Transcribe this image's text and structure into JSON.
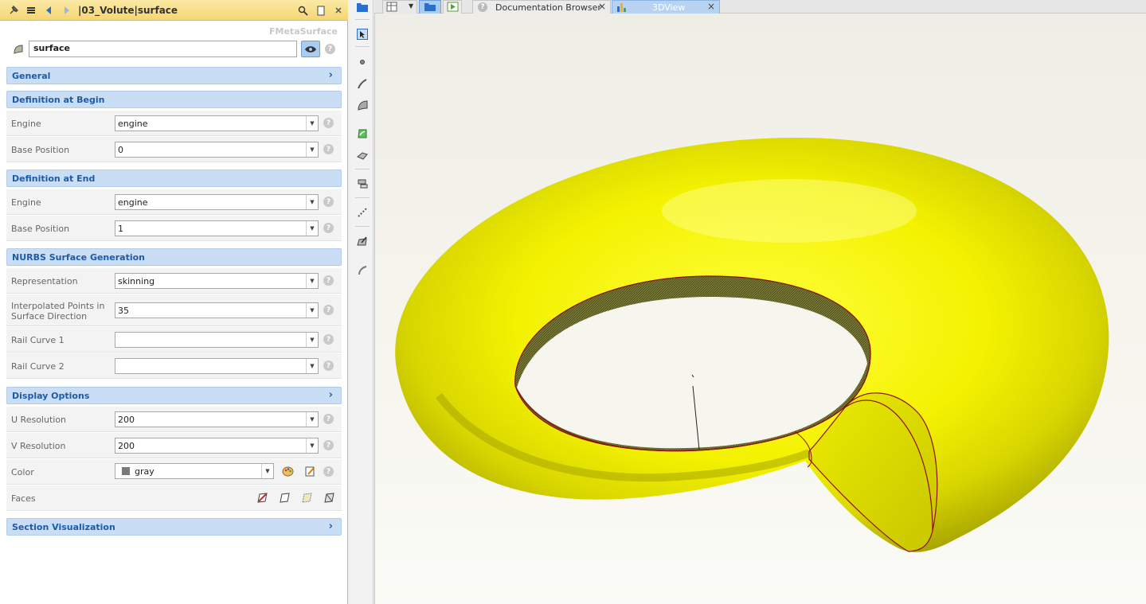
{
  "panel": {
    "title": "|03_Volute|surface",
    "class_label": "FMetaSurface",
    "name_value": "surface"
  },
  "sections": {
    "general": "General",
    "def_begin": "Definition at Begin",
    "def_end": "Definition at End",
    "nurbs": "NURBS Surface Generation",
    "display": "Display Options",
    "section_vis": "Section Visualization"
  },
  "begin": {
    "engine_label": "Engine",
    "engine_value": "engine",
    "base_label": "Base Position",
    "base_value": "0"
  },
  "end": {
    "engine_label": "Engine",
    "engine_value": "engine",
    "base_label": "Base Position",
    "base_value": "1"
  },
  "nurbs": {
    "rep_label": "Representation",
    "rep_value": "skinning",
    "interp_label_1": "Interpolated Points in",
    "interp_label_2": "Surface Direction",
    "interp_value": "35",
    "rail1_label": "Rail Curve 1",
    "rail1_value": "",
    "rail2_label": "Rail Curve 2",
    "rail2_value": ""
  },
  "display": {
    "u_label": "U Resolution",
    "u_value": "200",
    "v_label": "V Resolution",
    "v_value": "200",
    "color_label": "Color",
    "color_value": "gray",
    "color_swatch": "#7a7a7a",
    "faces_label": "Faces"
  },
  "help_glyph": "?",
  "chevron_glyph": "›",
  "tabs": {
    "doc": "Documentation Browser",
    "view3d": "3DView",
    "close": "×"
  },
  "colors": {
    "surface": "#f2f200",
    "section_header": "#c9def4",
    "titlebar": "#f6d675",
    "edge": "#8a1010"
  },
  "icons": [
    "pin-icon",
    "menu-icon",
    "back-icon",
    "forward-icon",
    "search-icon",
    "copy-icon",
    "close-icon",
    "surface-icon",
    "eye-icon",
    "help-icon"
  ]
}
